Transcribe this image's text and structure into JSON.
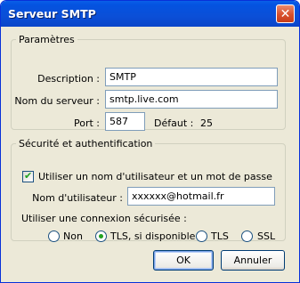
{
  "window": {
    "title": "Serveur SMTP",
    "close_glyph": "✕"
  },
  "parametres": {
    "legend": "Paramètres",
    "description_label": "Description :",
    "description_value": "SMTP",
    "server_label": "Nom du serveur :",
    "server_value": "smtp.live.com",
    "port_label": "Port :",
    "port_value": "587",
    "default_label": "Défaut :",
    "default_value": "25"
  },
  "securite": {
    "legend": "Sécurité et authentification",
    "use_credentials_label": "Utiliser un nom d'utilisateur et un mot de passe",
    "use_credentials_checked": true,
    "username_label": "Nom d'utilisateur :",
    "username_value": "xxxxxx@hotmail.fr",
    "secure_conn_label": "Utiliser une connexion sécurisée :",
    "options": [
      {
        "label": "Non",
        "selected": false
      },
      {
        "label": "TLS, si disponible",
        "selected": true
      },
      {
        "label": "TLS",
        "selected": false
      },
      {
        "label": "SSL",
        "selected": false
      }
    ]
  },
  "buttons": {
    "ok": "OK",
    "cancel": "Annuler"
  }
}
